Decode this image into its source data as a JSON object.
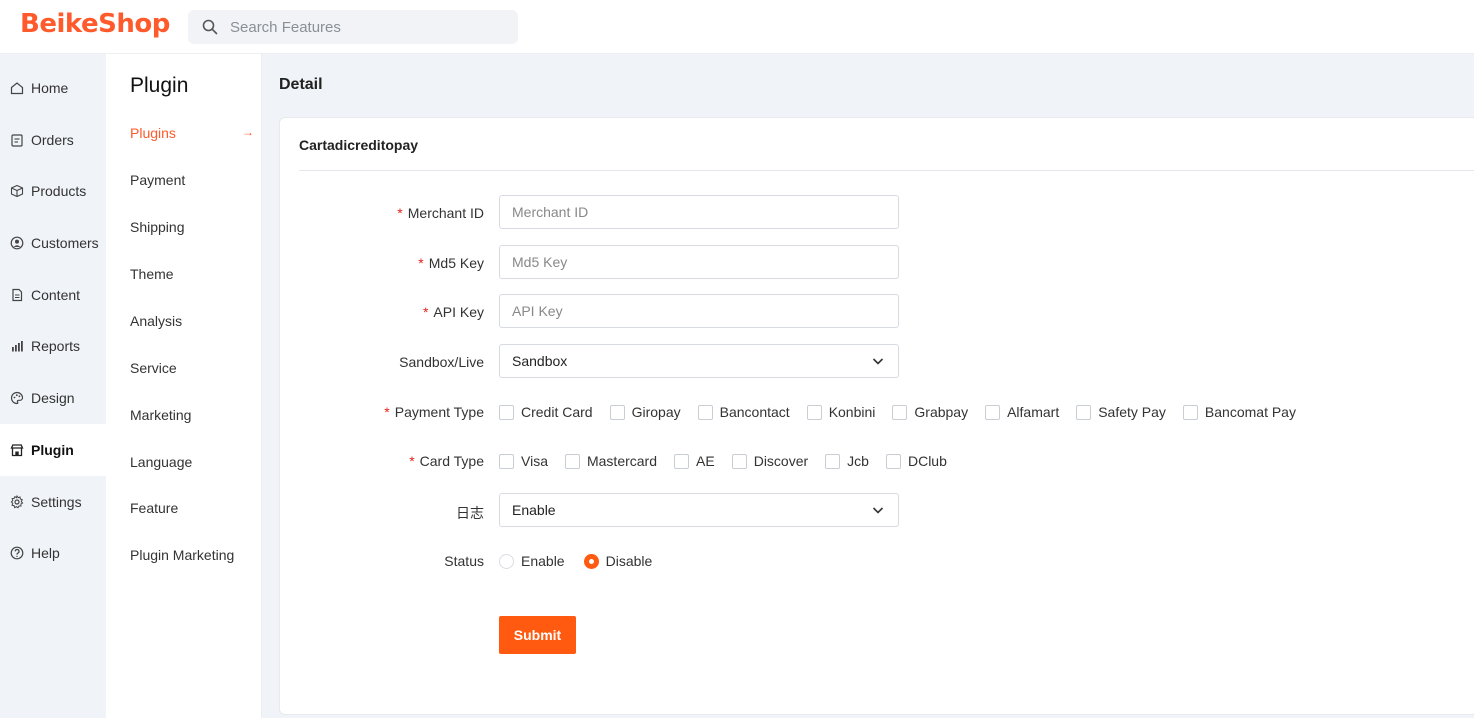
{
  "brand": {
    "name": "BeikeShop",
    "color": "#ff5a2c"
  },
  "search": {
    "placeholder": "Search Features",
    "icon": "search-icon"
  },
  "sidebar": {
    "items": [
      {
        "label": "Home",
        "icon": "home-icon"
      },
      {
        "label": "Orders",
        "icon": "clipboard-icon"
      },
      {
        "label": "Products",
        "icon": "box-icon"
      },
      {
        "label": "Customers",
        "icon": "user-circle-icon"
      },
      {
        "label": "Content",
        "icon": "document-icon"
      },
      {
        "label": "Reports",
        "icon": "bar-chart-icon"
      },
      {
        "label": "Design",
        "icon": "palette-icon"
      },
      {
        "label": "Plugin",
        "icon": "store-icon",
        "active": true
      },
      {
        "label": "Settings",
        "icon": "gear-icon"
      },
      {
        "label": "Help",
        "icon": "help-icon"
      }
    ]
  },
  "subnav": {
    "title": "Plugin",
    "links": [
      "Plugins",
      "Payment",
      "Shipping",
      "Theme",
      "Analysis",
      "Service",
      "Marketing",
      "Language",
      "Feature",
      "Plugin Marketing"
    ],
    "active_arrow": "→"
  },
  "page": {
    "title": "Detail",
    "card_title": "Cartadicreditopay"
  },
  "form": {
    "merchant_id": {
      "label": "Merchant ID",
      "placeholder": "Merchant ID"
    },
    "md5_key": {
      "label": "Md5 Key",
      "placeholder": "Md5 Key"
    },
    "api_key": {
      "label": "API Key",
      "placeholder": "API Key"
    },
    "sandbox": {
      "label": "Sandbox/Live",
      "value": "Sandbox"
    },
    "payment_type": {
      "label": "Payment Type",
      "options": [
        "Credit Card",
        "Giropay",
        "Bancontact",
        "Konbini",
        "Grabpay",
        "Alfamart",
        "Safety Pay",
        "Bancomat Pay"
      ]
    },
    "card_type": {
      "label": "Card Type",
      "options": [
        "Visa",
        "Mastercard",
        "AE",
        "Discover",
        "Jcb",
        "DClub"
      ]
    },
    "log": {
      "label": "日志",
      "value": "Enable"
    },
    "status": {
      "label": "Status",
      "options": [
        "Enable",
        "Disable"
      ],
      "selected": "Disable"
    },
    "required_mark": "*",
    "submit_label": "Submit"
  },
  "colors": {
    "accent": "#ff5a0f",
    "required": "#e2231a"
  }
}
